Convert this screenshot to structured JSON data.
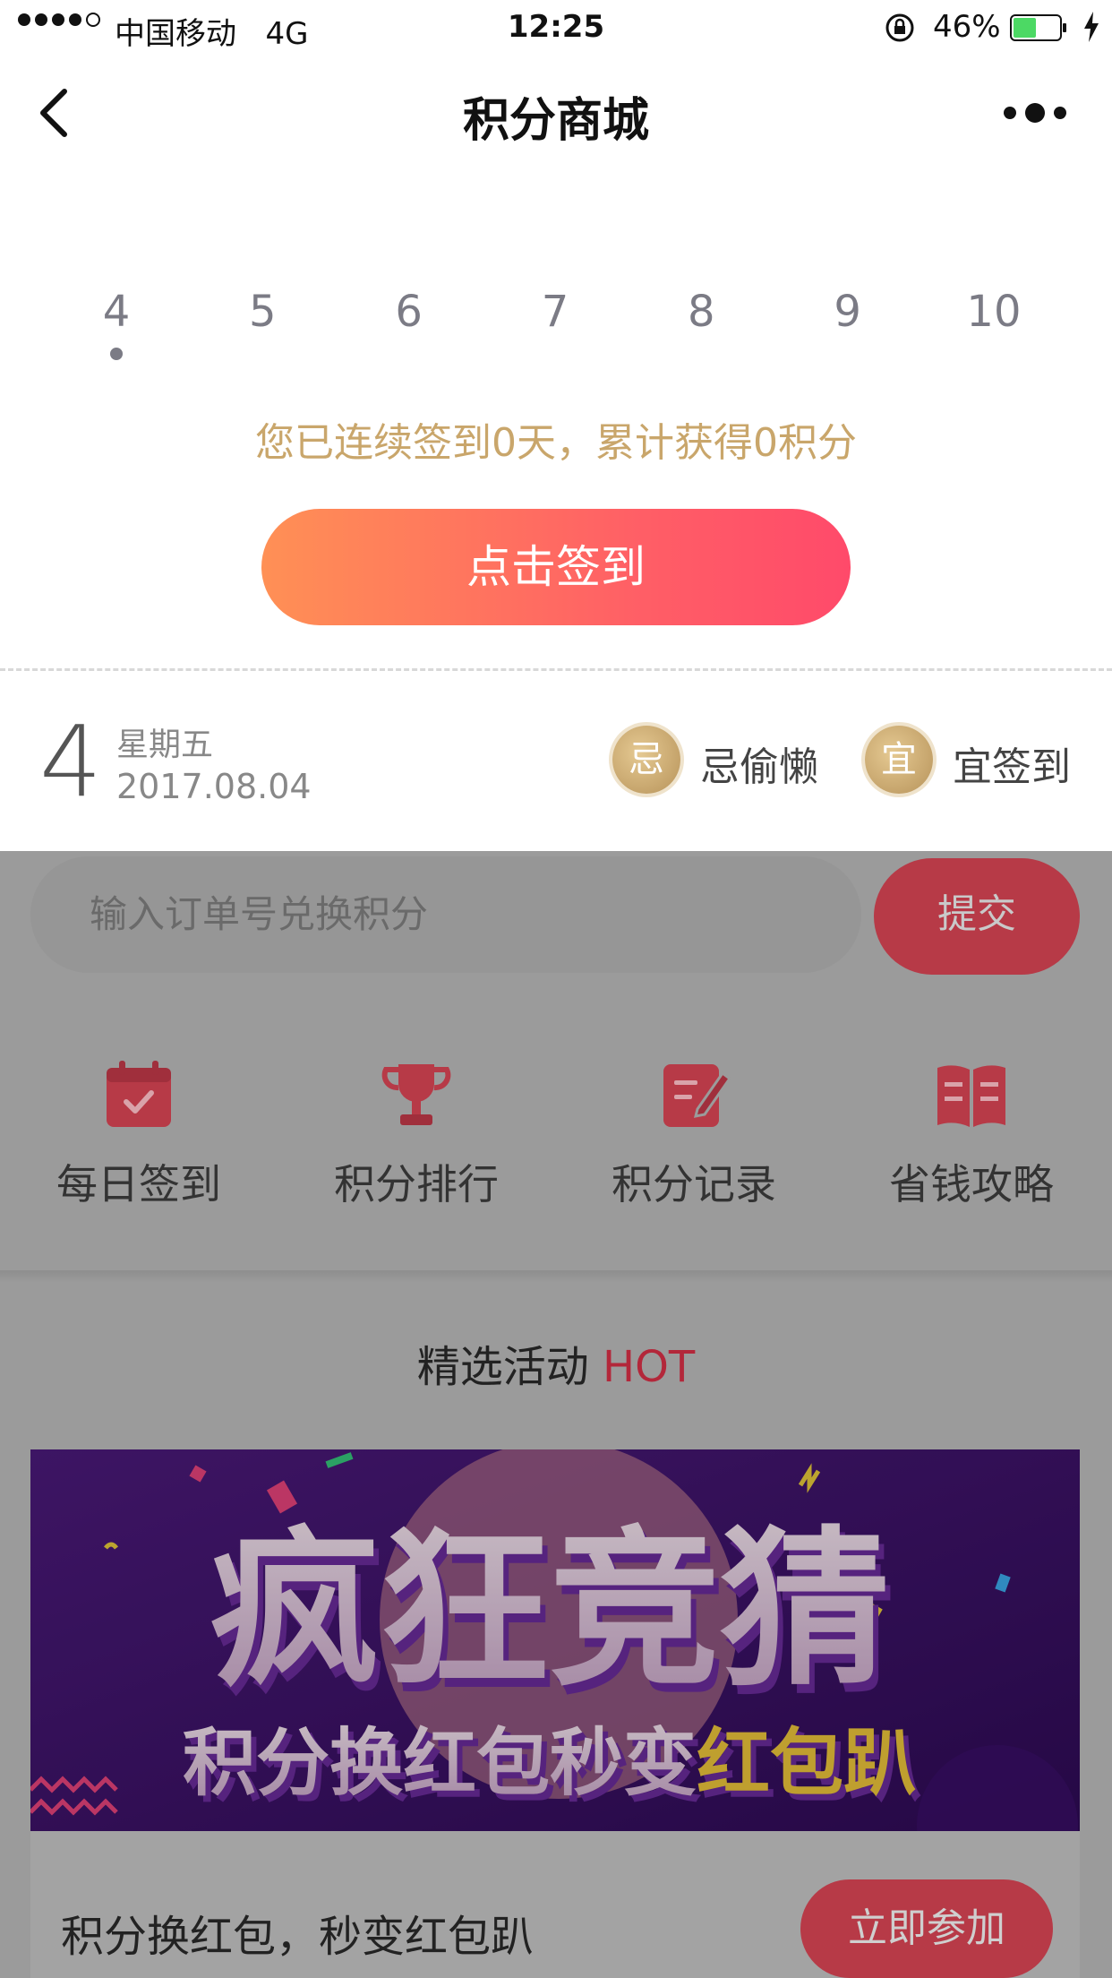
{
  "status_bar": {
    "carrier": "中国移动",
    "network": "4G",
    "time": "12:25",
    "battery": "46%"
  },
  "nav": {
    "title": "积分商城",
    "back_icon": "chevron-left-icon",
    "more_icon": "more-dots-icon"
  },
  "date_strip": {
    "days": [
      "4",
      "5",
      "6",
      "7",
      "8",
      "9",
      "10"
    ],
    "selected_index": 0
  },
  "checkin": {
    "summary": "您已连续签到0天，累计获得0积分",
    "button_label": "点击签到"
  },
  "today": {
    "day": "4",
    "weekday": "星期五",
    "date": "2017.08.04",
    "avoid_badge": "忌",
    "avoid_text": "忌偷懒",
    "suitable_badge": "宜",
    "suitable_text": "宜签到"
  },
  "redeem": {
    "placeholder": "输入订单号兑换积分",
    "submit_label": "提交"
  },
  "quick_nav": [
    {
      "label": "每日签到",
      "icon": "calendar-check-icon"
    },
    {
      "label": "积分排行",
      "icon": "trophy-icon"
    },
    {
      "label": "积分记录",
      "icon": "notepad-pen-icon"
    },
    {
      "label": "省钱攻略",
      "icon": "open-book-icon"
    }
  ],
  "section": {
    "title": "精选活动",
    "hot": "HOT"
  },
  "banner": {
    "headline": "疯狂竞猜",
    "subline_main": "积分换红包秒变",
    "subline_highlight": "红包趴"
  },
  "activity": {
    "text": "积分换红包，秒变红包趴",
    "join_label": "立即参加"
  },
  "colors": {
    "gold": "#c9a66b",
    "button_gradient_start": "#ff9055",
    "button_gradient_end": "#ff4a6a",
    "hot_red": "#b3273a",
    "banner_purple": "#3b1068"
  }
}
